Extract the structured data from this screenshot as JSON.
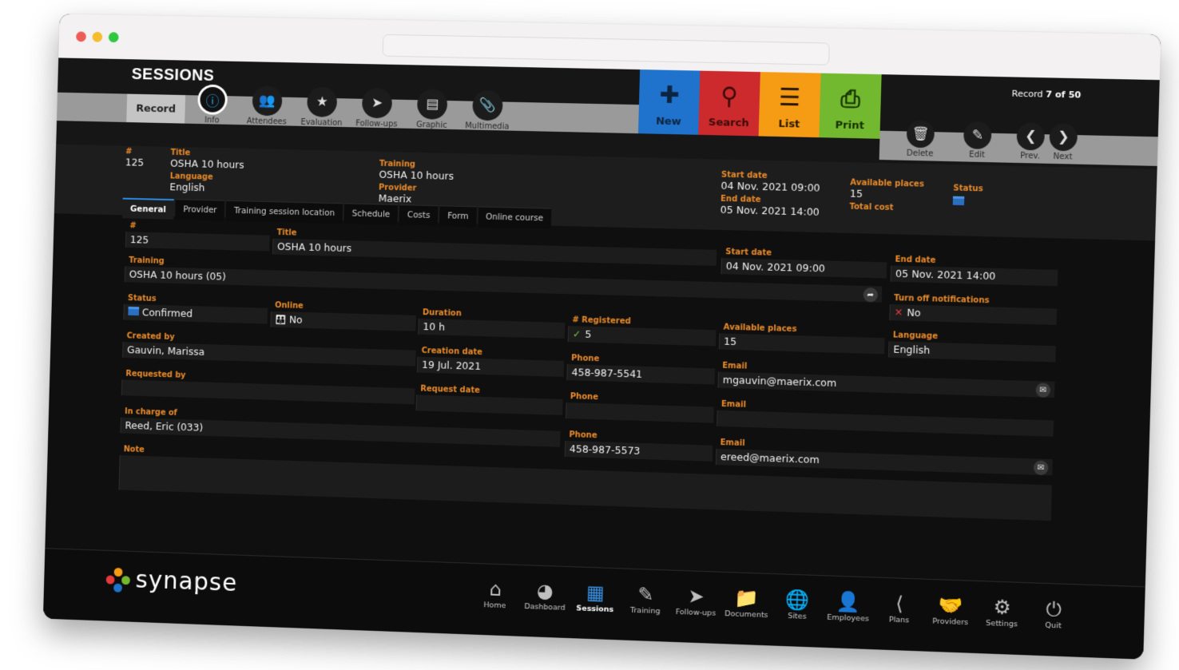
{
  "window": {
    "url": ""
  },
  "header": {
    "title": "SESSIONS",
    "record_tab": "Record",
    "record_counter_prefix": "Record ",
    "record_counter_value": "7 of 50",
    "tool_icons": [
      {
        "label": "Info",
        "icon": "info-pin-icon"
      },
      {
        "label": "Attendees",
        "icon": "attendees-icon"
      },
      {
        "label": "Evaluation",
        "icon": "star-icon"
      },
      {
        "label": "Follow-ups",
        "icon": "paper-plane-icon"
      },
      {
        "label": "Graphic",
        "icon": "chart-icon"
      },
      {
        "label": "Multimedia",
        "icon": "paperclip-icon"
      }
    ],
    "action_buttons": [
      {
        "label": "New",
        "icon": "plus-icon",
        "color": "#1f73cd"
      },
      {
        "label": "Search",
        "icon": "magnifier-icon",
        "color": "#cc2a2c"
      },
      {
        "label": "List",
        "icon": "list-icon",
        "color": "#f59c14"
      },
      {
        "label": "Print",
        "icon": "printer-icon",
        "color": "#72b92f"
      }
    ],
    "nav_icons": [
      {
        "label": "Delete",
        "icon": "trash-icon"
      },
      {
        "label": "Edit",
        "icon": "pencil-icon"
      },
      {
        "label": "Prev.",
        "icon": "chevron-left-icon"
      },
      {
        "label": "Next",
        "icon": "chevron-right-icon"
      }
    ]
  },
  "summary": {
    "number": {
      "label": "#",
      "value": "125"
    },
    "title": {
      "label": "Title",
      "value": "OSHA 10 hours"
    },
    "language": {
      "label": "Language",
      "value": "English"
    },
    "training": {
      "label": "Training",
      "value": "OSHA 10 hours"
    },
    "provider": {
      "label": "Provider",
      "value": "Maerix"
    },
    "start_date": {
      "label": "Start date",
      "value": "04 Nov. 2021 09:00"
    },
    "end_date": {
      "label": "End date",
      "value": "05 Nov. 2021 14:00"
    },
    "available_places": {
      "label": "Available places",
      "value": "15"
    },
    "total_cost": {
      "label": "Total cost",
      "value": ""
    },
    "status": {
      "label": "Status"
    }
  },
  "tabs": [
    "General",
    "Provider",
    "Training session location",
    "Schedule",
    "Costs",
    "Form",
    "Online course"
  ],
  "form": {
    "number": {
      "label": "#",
      "value": "125"
    },
    "title": {
      "label": "Title",
      "value": "OSHA 10 hours"
    },
    "start_date": {
      "label": "Start date",
      "value": "04 Nov. 2021 09:00"
    },
    "end_date": {
      "label": "End date",
      "value": "05 Nov. 2021 14:00"
    },
    "training": {
      "label": "Training",
      "value": "OSHA 10 hours (05)"
    },
    "turn_off_notifications": {
      "label": "Turn off notifications",
      "value": "No"
    },
    "status": {
      "label": "Status",
      "value": "Confirmed"
    },
    "online": {
      "label": "Online",
      "value": "No"
    },
    "duration": {
      "label": "Duration",
      "value": "10 h"
    },
    "registered": {
      "label": "# Registered",
      "value": "5"
    },
    "available_places": {
      "label": "Available places",
      "value": "15"
    },
    "language": {
      "label": "Language",
      "value": "English"
    },
    "created_by": {
      "label": "Created by",
      "value": "Gauvin, Marissa"
    },
    "creation_date": {
      "label": "Creation date",
      "value": "19 Jul. 2021"
    },
    "created_phone": {
      "label": "Phone",
      "value": "458-987-5541"
    },
    "created_email": {
      "label": "Email",
      "value": "mgauvin@maerix.com"
    },
    "requested_by": {
      "label": "Requested by",
      "value": ""
    },
    "request_date": {
      "label": "Request date",
      "value": ""
    },
    "requested_phone": {
      "label": "Phone",
      "value": ""
    },
    "requested_email": {
      "label": "Email",
      "value": ""
    },
    "in_charge_of": {
      "label": "In charge of",
      "value": "Reed, Eric (033)"
    },
    "in_charge_phone": {
      "label": "Phone",
      "value": "458-987-5573"
    },
    "in_charge_email": {
      "label": "Email",
      "value": "ereed@maerix.com"
    },
    "note": {
      "label": "Note",
      "value": ""
    }
  },
  "footer": {
    "brand": "synapse",
    "nav": [
      {
        "label": "Home",
        "icon": "home-icon"
      },
      {
        "label": "Dashboard",
        "icon": "gauge-icon"
      },
      {
        "label": "Sessions",
        "icon": "calendar-icon",
        "active": true
      },
      {
        "label": "Training",
        "icon": "diploma-icon"
      },
      {
        "label": "Follow-ups",
        "icon": "paper-plane-icon"
      },
      {
        "label": "Documents",
        "icon": "folder-icon"
      },
      {
        "label": "Sites",
        "icon": "globe-pin-icon"
      },
      {
        "label": "Employees",
        "icon": "employee-icon"
      },
      {
        "label": "Plans",
        "icon": "share-nodes-icon"
      },
      {
        "label": "Providers",
        "icon": "handshake-icon"
      },
      {
        "label": "Settings",
        "icon": "gear-icon"
      },
      {
        "label": "Quit",
        "icon": "power-icon"
      }
    ]
  }
}
